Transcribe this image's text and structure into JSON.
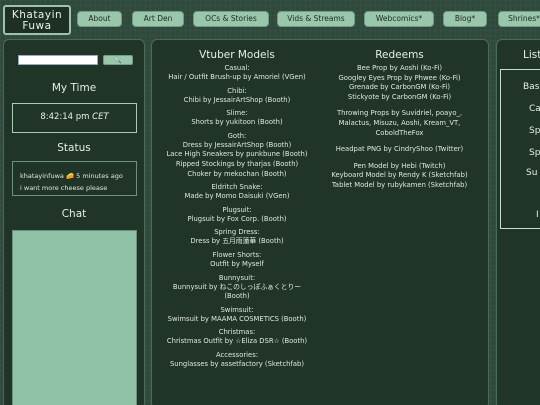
{
  "logo": {
    "line1": "Khatayin",
    "line2": "Fuwa"
  },
  "nav": [
    "About",
    "Art Den",
    "OCs & Stories",
    "Vids & Streams",
    "Webcomics*",
    "Blog*",
    "Shrines*"
  ],
  "left": {
    "search": {
      "placeholder": "",
      "button": "🔍"
    },
    "my_time_title": "My Time",
    "time_value": "8:42:14 pm",
    "time_zone": "CET",
    "status_title": "Status",
    "status_user": "khatayinfuwa",
    "status_emoji": "🧀",
    "status_ago": "5 minutes ago",
    "status_text": "i want more cheese please",
    "chat_title": "Chat"
  },
  "vtuber": {
    "title": "Vtuber Models",
    "entries": [
      {
        "title": "Casual:",
        "lines": [
          "Hair / Outfit Brush-up by Amoriel (VGen)"
        ]
      },
      {
        "title": "Chibi:",
        "lines": [
          "Chibi by JessairArtShop (Booth)"
        ]
      },
      {
        "title": "Slime:",
        "lines": [
          "Shorts by yukitoon (Booth)"
        ]
      },
      {
        "title": "Goth:",
        "lines": [
          "Dress by JessairArtShop (Booth)",
          "Lace High Sneakers by punkbune (Booth)",
          "Ripped Stockings by tharjas (Booth)",
          "Choker by mekochan (Booth)"
        ]
      },
      {
        "title": "Eldritch Snake:",
        "lines": [
          "Made by Momo Daisuki (VGen)"
        ]
      },
      {
        "title": "Plugsuit:",
        "lines": [
          "Plugsuit by Fox Corp. (Booth)"
        ]
      },
      {
        "title": "Spring Dress:",
        "lines": [
          "Dress by 五月雨蓮華 (Booth)"
        ]
      },
      {
        "title": "Flower Shorts:",
        "lines": [
          "Outfit by Myself"
        ]
      },
      {
        "title": "Bunnysuit:",
        "lines": [
          "Bunnysuit by ねこのしっぽふぁくとりー",
          "(Booth)"
        ]
      },
      {
        "title": "Swimsuit:",
        "lines": [
          "Swimsuit by MAAMA COSMETICS (Booth)"
        ]
      },
      {
        "title": "Christmas:",
        "lines": [
          "Christmas Outfit by ☆Eliza DSR☆ (Booth)"
        ]
      },
      {
        "title": "Accessories:",
        "lines": [
          "Sunglasses by assetfactory (Sketchfab)"
        ]
      }
    ]
  },
  "redeems": {
    "title": "Redeems",
    "groups": [
      [
        "Bee Prop by Aoshi (Ko-Fi)",
        "Googley Eyes Prop by Phwee (Ko-Fi)",
        "Grenade by CarbonGM (Ko-Fi)",
        "Stickyote by CarbonGM (Ko-Fi)"
      ],
      [
        "Throwing Props by Suvidriel, poayo_,",
        "Malactus, Misuzu, Aoshi, Kream_VT,",
        "CoboldTheFox"
      ],
      [
        "Headpat PNG by CindryShoo (Twitter)"
      ],
      [
        "Pen Model by Hebi (Twitch)",
        "Keyboard Model by Rendy K (Sketchfab)",
        "Tablet Model by rubykamen (Sketchfab)"
      ]
    ]
  },
  "right": {
    "title": "List",
    "items": [
      "Bas",
      "Ca",
      "Sp",
      "Sp",
      "Su",
      "I"
    ]
  }
}
